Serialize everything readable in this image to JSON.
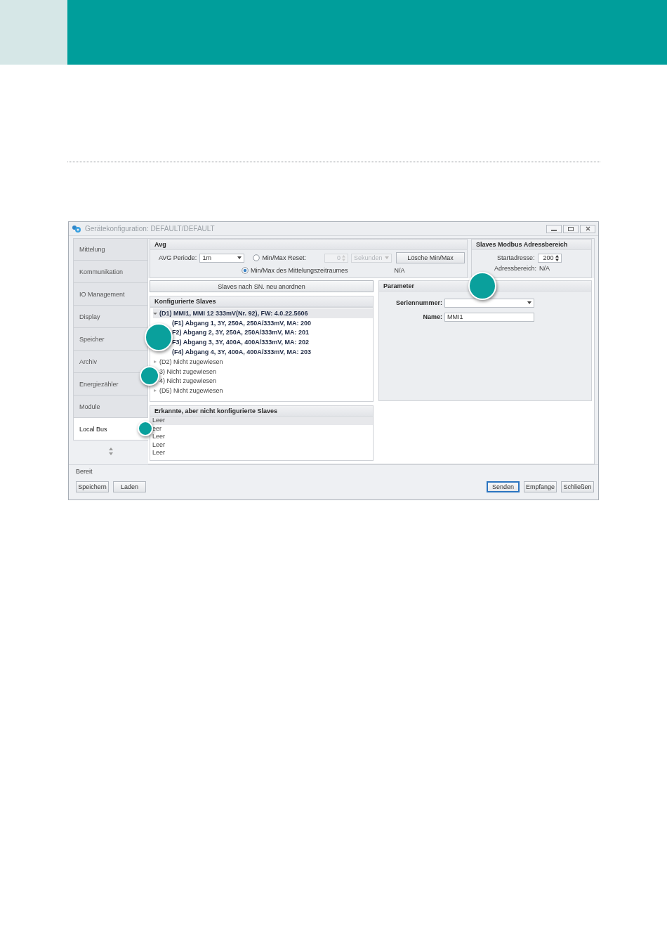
{
  "window": {
    "title": "Gerätekonfiguration: DEFAULT/DEFAULT"
  },
  "nav": [
    {
      "label": "Mittelung",
      "selected": false
    },
    {
      "label": "Kommunikation",
      "selected": false
    },
    {
      "label": "IO Management",
      "selected": false
    },
    {
      "label": "Display",
      "selected": false
    },
    {
      "label": "Speicher",
      "selected": false
    },
    {
      "label": "Archiv",
      "selected": false
    },
    {
      "label": "Energiezähler",
      "selected": false
    },
    {
      "label": "Module",
      "selected": false
    },
    {
      "label": "Local Bus",
      "selected": true
    }
  ],
  "avg": {
    "title": "Avg",
    "period_label": "AVG Periode:",
    "period_value": "1m",
    "reset_option": {
      "label": "Min/Max Reset:",
      "selected": false
    },
    "reset_value": {
      "value": "0",
      "disabled": true
    },
    "reset_unit": {
      "value": "Sekunden",
      "disabled": true
    },
    "clear_button": "Lösche Min/Max",
    "window_option": {
      "label": "Min/Max des Mittelungszeitraumes",
      "selected": true
    },
    "window_reading": "N/A"
  },
  "modbus": {
    "title": "Slaves Modbus Adressbereich",
    "start_label": "Startadresse:",
    "start_value": "200",
    "range_label": "Adressbereich:",
    "range_value": "N/A"
  },
  "sort_button": "Slaves nach SN. neu anordnen",
  "configured": {
    "title": "Konfigurierte Slaves",
    "tree": [
      {
        "label": "(D1) MMI1, MMI 12 333mV(Nr. 92), FW: 4.0.22.5606",
        "kind": "assigned",
        "expanded": true,
        "selected": true,
        "children": [
          {
            "label": "(F1) Abgang 1, 3Y, 250A, 250A/333mV, MA: 200",
            "selected": false
          },
          {
            "label": "F2) Abgang 2, 3Y, 250A, 250A/333mV, MA: 201",
            "selected": false
          },
          {
            "label": "F3) Abgang 3, 3Y, 400A, 400A/333mV, MA: 202",
            "selected": false
          },
          {
            "label": "(F4) Abgang 4, 3Y, 400A, 400A/333mV, MA: 203",
            "selected": false
          }
        ]
      },
      {
        "label": "(D2) Nicht zugewiesen",
        "kind": "empty",
        "expanded": false,
        "selected": false
      },
      {
        "label": "3) Nicht zugewiesen",
        "kind": "empty",
        "selected": false
      },
      {
        "label": "4) Nicht zugewiesen",
        "kind": "empty",
        "selected": false
      },
      {
        "label": "(D5) Nicht zugewiesen",
        "kind": "empty",
        "expanded": false,
        "selected": false
      }
    ]
  },
  "detected": {
    "title": "Erkannte, aber nicht konfigurierte Slaves",
    "items": [
      {
        "label": "Leer",
        "selected": true
      },
      {
        "label": "eer",
        "selected": false
      },
      {
        "label": "Leer",
        "selected": false
      },
      {
        "label": "Leer",
        "selected": false
      },
      {
        "label": "Leer",
        "selected": false
      }
    ]
  },
  "parameter": {
    "title": "Parameter",
    "serial_label": "Seriennummer:",
    "name_label": "Name:",
    "name_value": "MMI1"
  },
  "status_bar": "Bereit",
  "footer": {
    "left_buttons": [
      {
        "label": "Speichern",
        "focused": false
      },
      {
        "label": "Laden",
        "focused": false
      }
    ],
    "right_buttons": [
      {
        "label": "Senden",
        "focused": true
      },
      {
        "label": "Empfange",
        "focused": false
      },
      {
        "label": "Schließen",
        "focused": false
      }
    ]
  }
}
